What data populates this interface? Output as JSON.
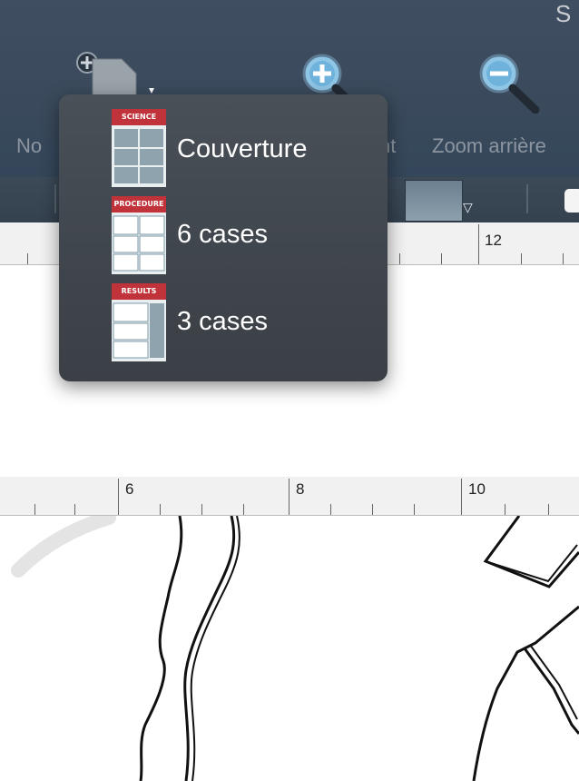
{
  "window": {
    "title_fragment": "S"
  },
  "toolbar": {
    "new_label": "No",
    "zoom_in_label": "nt",
    "zoom_out_label": "Zoom arrière"
  },
  "popup_menu": {
    "items": [
      {
        "label": "Couverture",
        "preview_header": "SCIENCE"
      },
      {
        "label": "6 cases",
        "preview_header": "PROCEDURE"
      },
      {
        "label": "3 cases",
        "preview_header": "RESULTS"
      }
    ]
  },
  "ruler_top": {
    "numbers": [
      "12"
    ]
  },
  "ruler_mid": {
    "numbers": [
      "6",
      "8",
      "10"
    ]
  },
  "colors": {
    "toolbar": "#3a4a5c",
    "popup": "#44494f",
    "accent_red": "#c0333a"
  }
}
